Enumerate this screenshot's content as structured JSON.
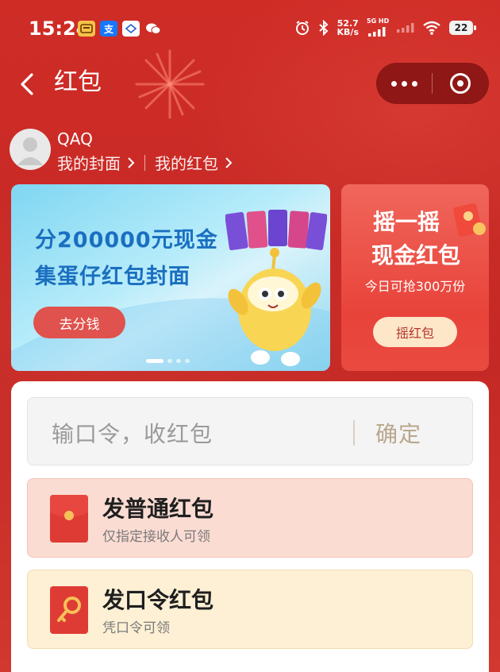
{
  "status_bar": {
    "time": "15:24",
    "net_speed": "52.7",
    "net_unit": "KB/s",
    "net_type": "5G HD",
    "battery": "22",
    "chips": [
      "pay-app-icon",
      "alipay-icon",
      "zhongxin-icon",
      "wechat-icon"
    ]
  },
  "nav": {
    "title": "红包"
  },
  "user": {
    "name": "QAQ",
    "my_cover": "我的封面",
    "my_redpacket": "我的红包"
  },
  "banner": {
    "line1": "分200000元现金",
    "line2": "集蛋仔红包封面",
    "button": "去分钱",
    "slides": 4,
    "active_slide": 1
  },
  "shake": {
    "title1": "摇一摇",
    "title2": "现金红包",
    "subtitle": "今日可抢300万份",
    "button": "摇红包"
  },
  "code_input": {
    "placeholder": "输口令，收红包",
    "confirm": "确定"
  },
  "options": [
    {
      "title": "发普通红包",
      "desc": "仅指定接收人可领",
      "icon": "red-envelope-icon"
    },
    {
      "title": "发口令红包",
      "desc": "凭口令可领",
      "icon": "key-icon"
    }
  ],
  "colors": {
    "background": "#c92a26",
    "banner_text": "#1b6fc0",
    "accent_red": "#df3b35"
  }
}
